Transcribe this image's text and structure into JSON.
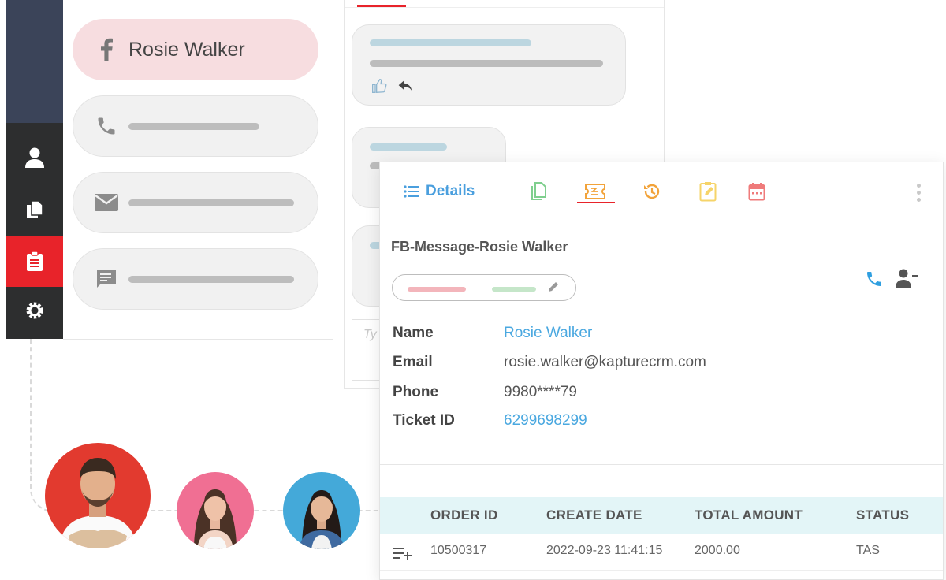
{
  "sidebar": {
    "items": [
      {
        "icon": "user-icon"
      },
      {
        "icon": "documents-icon"
      },
      {
        "icon": "clipboard-icon",
        "active": true
      },
      {
        "icon": "settings-icon"
      }
    ],
    "active_color": "#e8232a"
  },
  "contact_card": {
    "facebook_name": "Rosie Walker",
    "channels": [
      "phone-icon",
      "mail-icon",
      "chat-icon"
    ],
    "facebook_bg": "#f7dde0"
  },
  "chat": {
    "input_placeholder": "Ty"
  },
  "details": {
    "tabs": [
      {
        "label": "Details",
        "icon": "list-icon",
        "color": "#4a9fde"
      },
      {
        "label": "",
        "icon": "copy-icon",
        "color": "#7fcf8e"
      },
      {
        "label": "",
        "icon": "ticket-icon",
        "color": "#f2a33a",
        "active": true
      },
      {
        "label": "",
        "icon": "history-icon",
        "color": "#f2a33a"
      },
      {
        "label": "",
        "icon": "clipboard-edit-icon",
        "color": "#f6d46a"
      },
      {
        "label": "",
        "icon": "calendar-icon",
        "color": "#ef7b7b"
      }
    ],
    "ticket_title": "FB-Message-Rosie Walker",
    "fields": [
      {
        "label": "Name",
        "value": "Rosie Walker",
        "link": true
      },
      {
        "label": "Email",
        "value": "rosie.walker@kapturecrm.com",
        "link": false
      },
      {
        "label": "Phone",
        "value": "9980****79",
        "link": false
      },
      {
        "label": "Ticket ID",
        "value": "6299698299",
        "link": true
      }
    ],
    "orders": {
      "columns": [
        "ORDER ID",
        "CREATE DATE",
        "TOTAL AMOUNT",
        "STATUS"
      ],
      "rows": [
        {
          "order_id": "10500317",
          "create_date": "2022-09-23 11:41:15",
          "total_amount": "2000.00",
          "status": "TAS"
        }
      ]
    }
  },
  "avatars": [
    "man-avatar",
    "woman-avatar-1",
    "woman-avatar-2"
  ]
}
